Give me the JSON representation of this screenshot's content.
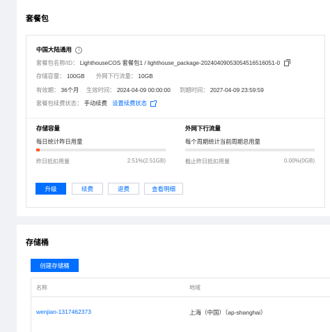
{
  "package_card": {
    "title": "套餐包",
    "region_title": "中国大陆通用",
    "info_icon": "info-circle-icon",
    "package_name_label": "套餐包名称/ID：",
    "package_name_value": "LighthouseCOS 套餐包1 / lighthouse_package-20240409053054516516051-0",
    "storage_capacity_label": "存储容量：",
    "storage_capacity_value": "100GB",
    "outbound_traffic_label": "外网下行流量：",
    "outbound_traffic_value": "10GB",
    "validity_label": "有效期：",
    "validity_value": "36个月",
    "effective_label": "生效时间：",
    "effective_value": "2024-04-09 00:00:00",
    "expire_label": "到期时间：",
    "expire_value": "2027-04-09 23:59:59",
    "renew_label": "套餐包续费状态：",
    "renew_value": "手动续费",
    "renew_link": "设置续费状态",
    "storage": {
      "title": "存储容量",
      "subtitle": "每日统计昨日用量",
      "usage_label": "昨日抵扣用量",
      "usage_value": "2.51%(2.51GB)",
      "usage_fraction": 0.0251
    },
    "traffic": {
      "title": "外网下行流量",
      "subtitle": "每个周期统计当前周期总用量",
      "usage_label": "截止昨日抵扣用量",
      "usage_value": "0.00%(0GB)",
      "usage_fraction": 0
    },
    "buttons": {
      "upgrade": "升级",
      "renew": "续费",
      "refund": "退费",
      "details": "查看明细"
    },
    "colors": {
      "primary": "#006eff",
      "usage_bar": "#ff5a1f"
    }
  },
  "bucket_card": {
    "title": "存储桶",
    "create_button": "创建存储桶",
    "columns": {
      "name": "名称",
      "region": "地域"
    },
    "rows": [
      {
        "name": "wenjian-1317462373",
        "region": "上海（中国）（ap-shanghai）"
      }
    ]
  }
}
